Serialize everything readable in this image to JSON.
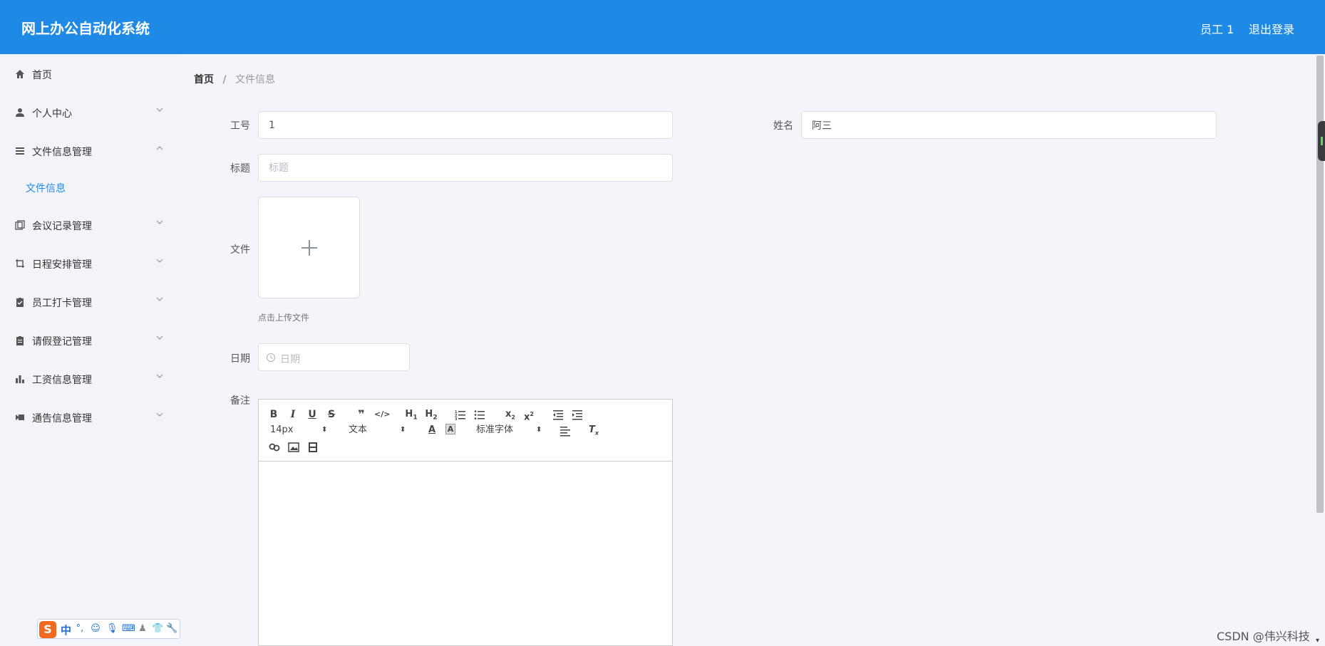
{
  "header": {
    "title": "网上办公自动化系统",
    "user": "员工 1",
    "logout": "退出登录",
    "bg_color": "#1f8ae6"
  },
  "sidebar": {
    "items": [
      {
        "label": "首页",
        "icon": "home-icon",
        "expandable": false
      },
      {
        "label": "个人中心",
        "icon": "user-icon",
        "expandable": true,
        "expanded": false
      },
      {
        "label": "文件信息管理",
        "icon": "list-icon",
        "expandable": true,
        "expanded": true
      },
      {
        "label": "会议记录管理",
        "icon": "copy-icon",
        "expandable": true,
        "expanded": false
      },
      {
        "label": "日程安排管理",
        "icon": "crop-icon",
        "expandable": true,
        "expanded": false
      },
      {
        "label": "员工打卡管理",
        "icon": "clipboard-check-icon",
        "expandable": true,
        "expanded": false
      },
      {
        "label": "请假登记管理",
        "icon": "clipboard-icon",
        "expandable": true,
        "expanded": false
      },
      {
        "label": "工资信息管理",
        "icon": "bar-chart-icon",
        "expandable": true,
        "expanded": false
      },
      {
        "label": "通告信息管理",
        "icon": "video-icon",
        "expandable": true,
        "expanded": false
      }
    ],
    "subitem": {
      "label": "文件信息",
      "active_color": "#1f8ae6"
    }
  },
  "breadcrumb": {
    "home": "首页",
    "separator": "/",
    "current": "文件信息"
  },
  "form": {
    "employee_no": {
      "label": "工号",
      "value": "1"
    },
    "name": {
      "label": "姓名",
      "value": "阿三"
    },
    "title": {
      "label": "标题",
      "value": "",
      "placeholder": "标题"
    },
    "file": {
      "label": "文件",
      "tip": "点击上传文件"
    },
    "date": {
      "label": "日期",
      "placeholder": "日期"
    },
    "remark": {
      "label": "备注"
    }
  },
  "editor": {
    "font_size": "14px",
    "text_type": "文本",
    "font_family": "标准字体",
    "buttons": [
      "B",
      "I",
      "U",
      "S",
      "❞",
      "</>",
      "H1",
      "H2",
      "ordered-list",
      "bullet-list",
      "x₂",
      "x²",
      "outdent",
      "indent",
      "A",
      "A",
      "align",
      "Tx",
      "link",
      "image",
      "video"
    ]
  },
  "ime": {
    "logo": "S",
    "mode": "中"
  },
  "watermark": "CSDN @伟兴科技"
}
